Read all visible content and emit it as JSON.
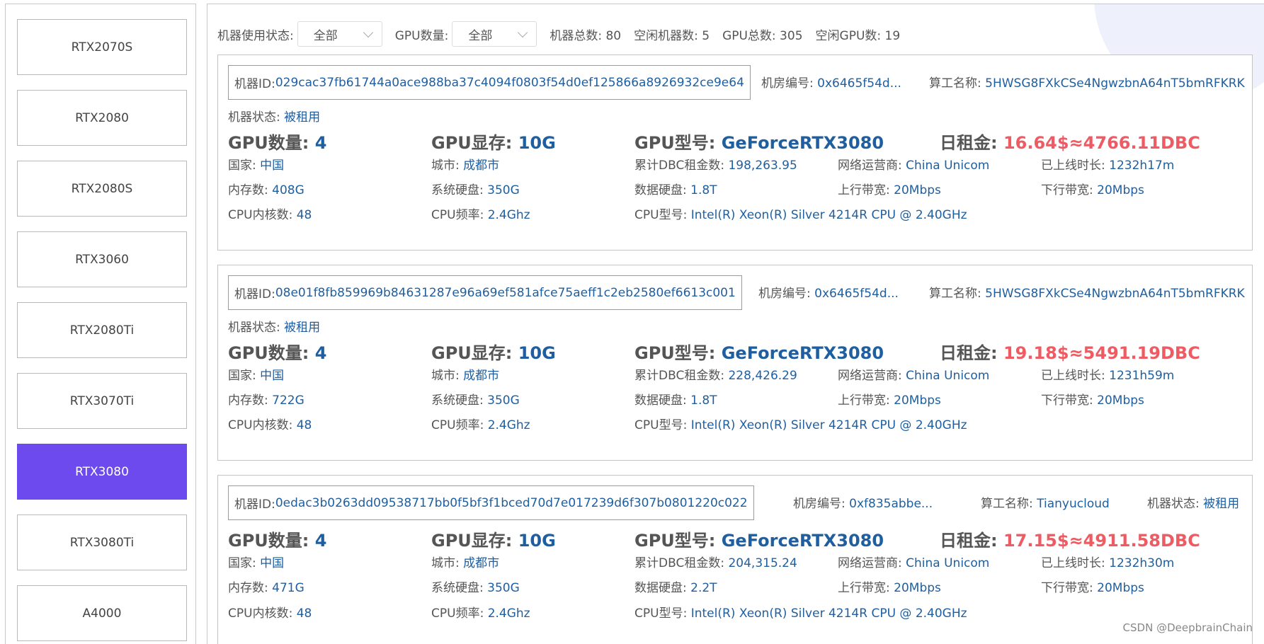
{
  "sidebar": {
    "items": [
      {
        "label": "RTX2070S"
      },
      {
        "label": "RTX2080"
      },
      {
        "label": "RTX2080S"
      },
      {
        "label": "RTX3060"
      },
      {
        "label": "RTX2080Ti"
      },
      {
        "label": "RTX3070Ti"
      },
      {
        "label": "RTX3080"
      },
      {
        "label": "RTX3080Ti"
      },
      {
        "label": "A4000"
      }
    ],
    "active_color": "#6c4aee"
  },
  "filters": {
    "status_label": "机器使用状态:",
    "status_value": "全部",
    "gpu_count_label": "GPU数量:",
    "gpu_count_value": "全部",
    "total_machines": "机器总数: 80",
    "idle_machines": "空闲机器数: 5",
    "total_gpus": "GPU总数: 305",
    "idle_gpus": "空闲GPU数: 19"
  },
  "labels": {
    "machine_id": "机器ID: ",
    "room_no": "机房编号: ",
    "operator": "算工名称: ",
    "status": "机器状态: ",
    "gpu_count": "GPU数量: ",
    "gpu_memory": "GPU显存: ",
    "gpu_model": "GPU型号: ",
    "daily_rent": "日租金: ",
    "country": "国家: ",
    "city": "城市: ",
    "total_dbc": "累计DBC租金数: ",
    "isp": "网络运营商: ",
    "uptime": "已上线时长: ",
    "memory": "内存数: ",
    "sys_disk": "系统硬盘: ",
    "data_disk": "数据硬盘: ",
    "upload": "上行带宽: ",
    "download": "下行带宽: ",
    "cpu_cores": "CPU内核数: ",
    "cpu_freq": "CPU频率: ",
    "cpu_model": "CPU型号: "
  },
  "machines": [
    {
      "id": "029cac37fb61744a0ace988ba37c4094f0803f54d0ef125866a8926932ce9e64",
      "room": "0x6465f54d...",
      "operator": "5HWSG8FXkCSe4NgwzbnA64nT5bmRFKRK",
      "status": "被租用",
      "gpu_count": "4",
      "gpu_memory": "10G",
      "gpu_model": "GeForceRTX3080",
      "daily_rent": "16.64$≈4766.11DBC",
      "country": "中国",
      "city": "成都市",
      "total_dbc": "198,263.95",
      "isp": "China Unicom",
      "uptime": "1232h17m",
      "memory": "408G",
      "sys_disk": "350G",
      "data_disk": "1.8T",
      "upload": "20Mbps",
      "download": "20Mbps",
      "cpu_cores": "48",
      "cpu_freq": "2.4Ghz",
      "cpu_model": "Intel(R) Xeon(R) Silver 4214R CPU @ 2.40GHz"
    },
    {
      "id": "08e01f8fb859969b84631287e96a69ef581afce75aeff1c2eb2580ef6613c001",
      "room": "0x6465f54d...",
      "operator": "5HWSG8FXkCSe4NgwzbnA64nT5bmRFKRK",
      "status": "被租用",
      "gpu_count": "4",
      "gpu_memory": "10G",
      "gpu_model": "GeForceRTX3080",
      "daily_rent": "19.18$≈5491.19DBC",
      "country": "中国",
      "city": "成都市",
      "total_dbc": "228,426.29",
      "isp": "China Unicom",
      "uptime": "1231h59m",
      "memory": "722G",
      "sys_disk": "350G",
      "data_disk": "1.8T",
      "upload": "20Mbps",
      "download": "20Mbps",
      "cpu_cores": "48",
      "cpu_freq": "2.4Ghz",
      "cpu_model": "Intel(R) Xeon(R) Silver 4214R CPU @ 2.40GHz"
    },
    {
      "id": "0edac3b0263dd09538717bb0f5bf3f1bced70d7e017239d6f307b0801220c022",
      "room": "0xf835abbe...",
      "operator": "Tianyucloud",
      "status": "被租用",
      "gpu_count": "4",
      "gpu_memory": "10G",
      "gpu_model": "GeForceRTX3080",
      "daily_rent": "17.15$≈4911.58DBC",
      "country": "中国",
      "city": "成都市",
      "total_dbc": "204,315.24",
      "isp": "China Unicom",
      "uptime": "1232h30m",
      "memory": "471G",
      "sys_disk": "350G",
      "data_disk": "2.2T",
      "upload": "20Mbps",
      "download": "20Mbps",
      "cpu_cores": "48",
      "cpu_freq": "2.4Ghz",
      "cpu_model": "Intel(R) Xeon(R) Silver 4214R CPU @ 2.40GHz"
    }
  ],
  "colors": {
    "value": "#1f5fa0",
    "price": "#ef5b63",
    "accent": "#6c4aee"
  },
  "watermark": "CSDN @DeepbrainChain"
}
